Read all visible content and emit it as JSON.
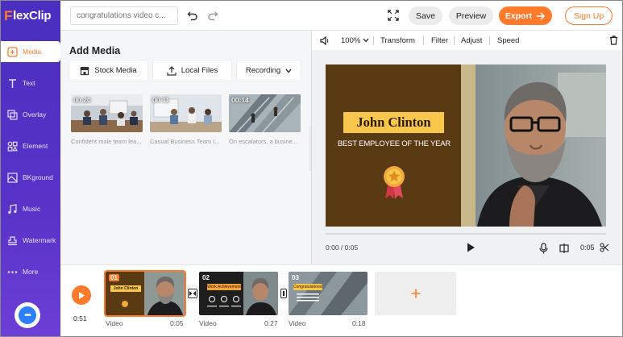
{
  "app": {
    "logo_mark": "F",
    "logo_text": "lexClip"
  },
  "header": {
    "project_name": "congratulations video c...",
    "save_label": "Save",
    "preview_label": "Preview",
    "export_label": "Export",
    "signup_label": "Sign Up"
  },
  "sidebar": {
    "items": [
      {
        "label": "Media",
        "icon": "media-icon"
      },
      {
        "label": "Text",
        "icon": "text-icon"
      },
      {
        "label": "Overlay",
        "icon": "overlay-icon"
      },
      {
        "label": "Element",
        "icon": "element-icon"
      },
      {
        "label": "BKground",
        "icon": "background-icon"
      },
      {
        "label": "Music",
        "icon": "music-icon"
      },
      {
        "label": "Watermark",
        "icon": "watermark-icon"
      },
      {
        "label": "More",
        "icon": "more-icon"
      }
    ]
  },
  "media": {
    "title": "Add Media",
    "stock_label": "Stock Media",
    "local_label": "Local Files",
    "recording_label": "Recording",
    "thumbs": [
      {
        "duration": "00:20",
        "caption": "Confident male team lea..."
      },
      {
        "duration": "00:11",
        "caption": "Casual Business Team I..."
      },
      {
        "duration": "00:14",
        "caption": "On escalators, a busine..."
      }
    ]
  },
  "preview": {
    "zoom": "100%",
    "tools": [
      "Transform",
      "Filter",
      "Adjust",
      "Speed"
    ],
    "name": "John Clinton",
    "subtitle": "BEST EMPLOYEE OF THE YEAR",
    "current_time": "0:00 / 0:05",
    "clip_time": "0:05"
  },
  "timeline": {
    "total": "0:51",
    "clips": [
      {
        "num": "01",
        "label": "Video",
        "duration": "0:05",
        "title_text": "John Clinton"
      },
      {
        "num": "02",
        "label": "Video",
        "duration": "0:27",
        "title_text": "Work Achievement"
      },
      {
        "num": "03",
        "label": "Video",
        "duration": "0:18",
        "title_text": "Congratulations!"
      }
    ]
  },
  "colors": {
    "brand_purple": "#4b2fc0",
    "accent_orange": "#ff7a2a",
    "name_yellow": "#f7c64a"
  }
}
